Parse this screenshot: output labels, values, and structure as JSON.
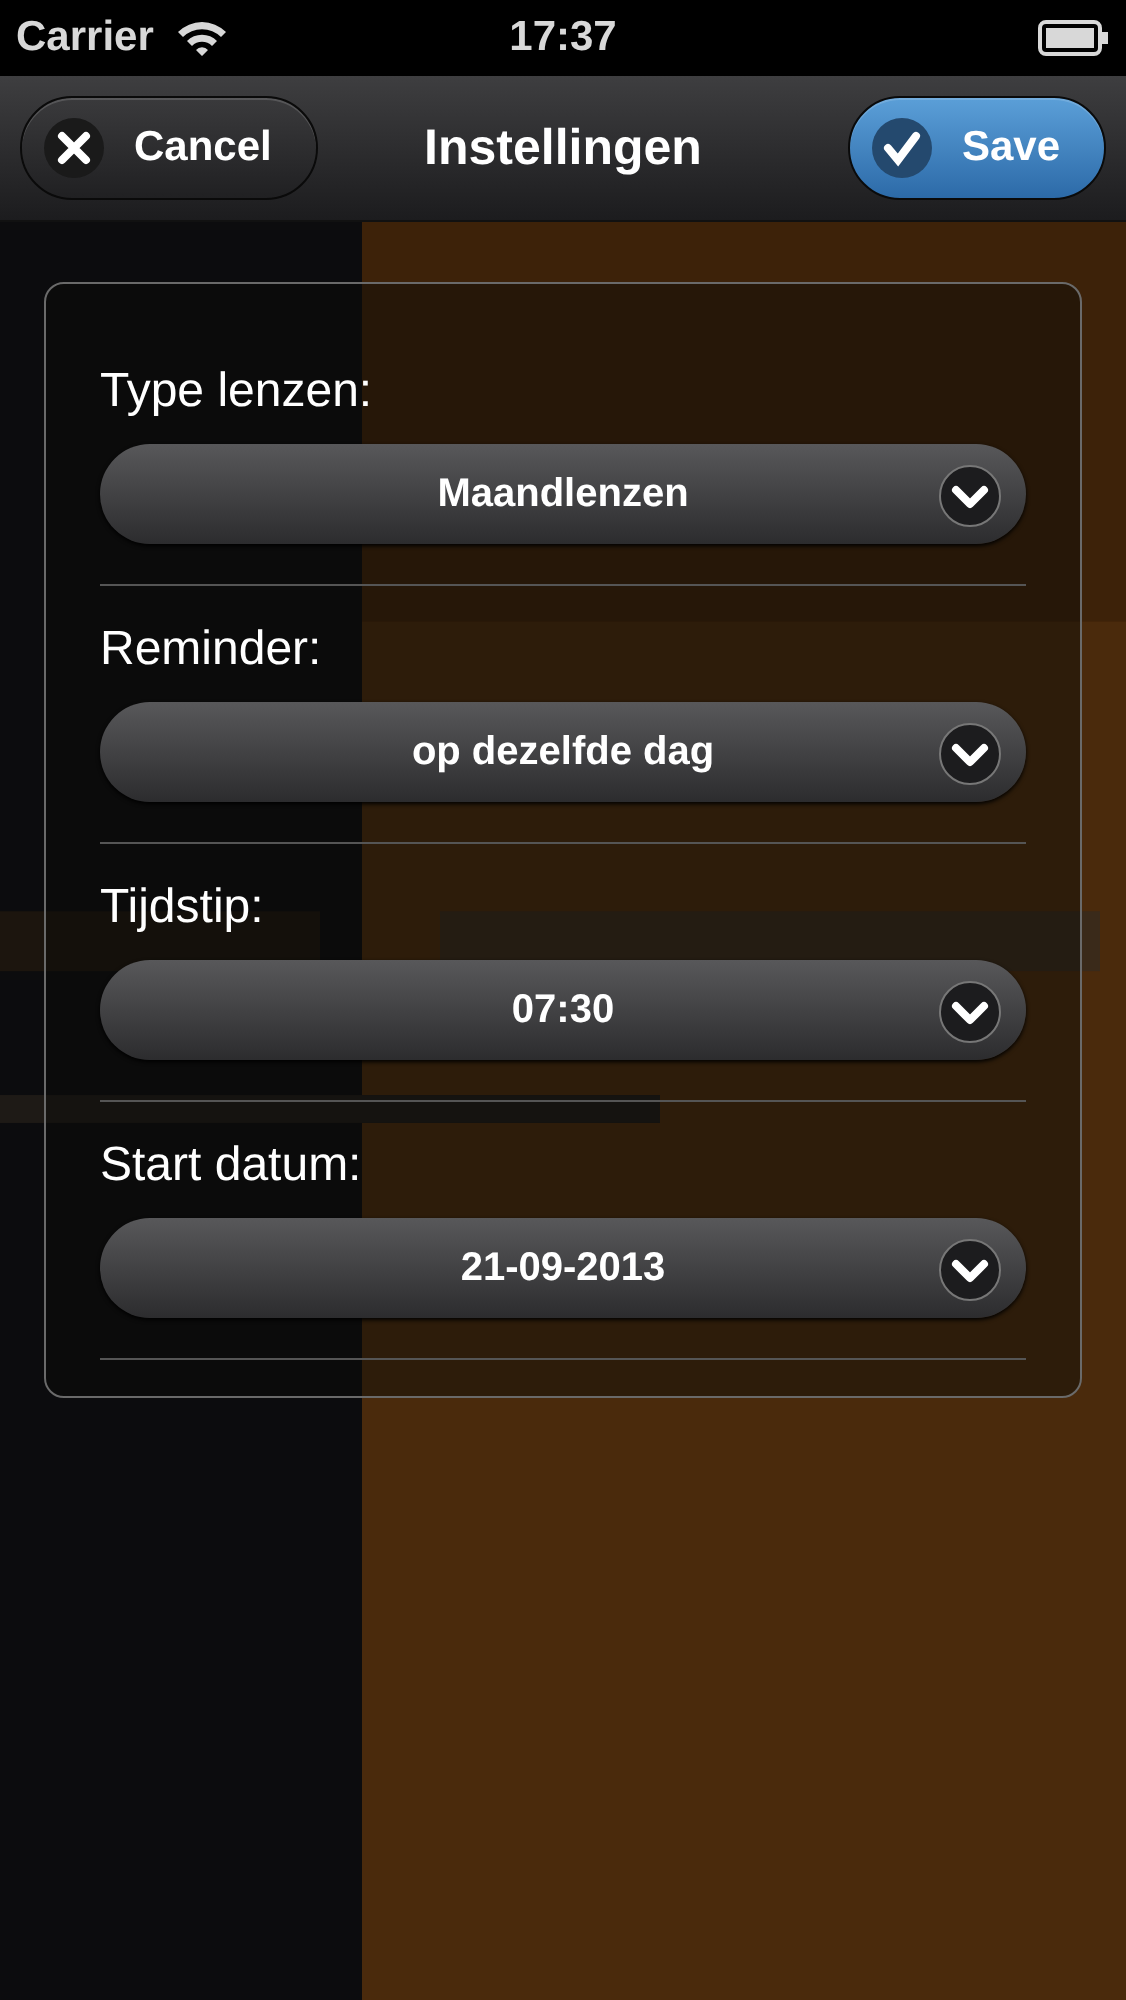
{
  "status_bar": {
    "carrier": "Carrier",
    "time": "17:37"
  },
  "nav_bar": {
    "title": "Instellingen",
    "cancel": "Cancel",
    "save": "Save"
  },
  "settings": [
    {
      "label": "Type lenzen:",
      "value": "Maandlenzen"
    },
    {
      "label": "Reminder:",
      "value": "op dezelfde dag"
    },
    {
      "label": "Tijdstip:",
      "value": "07:30"
    },
    {
      "label": "Start datum:",
      "value": "21-09-2013"
    }
  ]
}
